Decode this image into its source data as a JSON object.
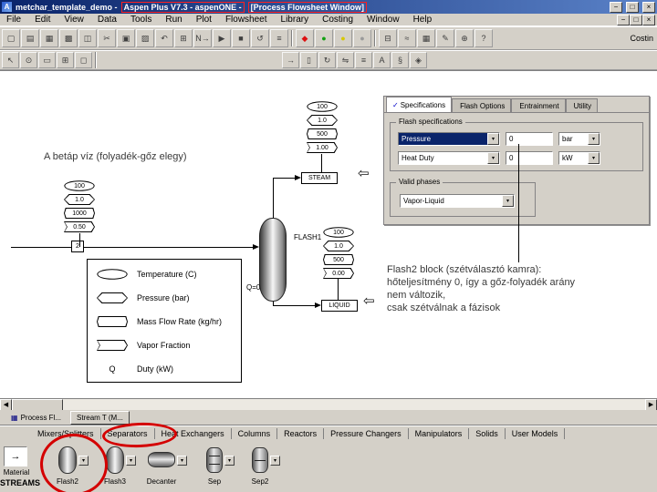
{
  "colors": {
    "title-blue-1": "#0a246a",
    "title-blue-2": "#5a82c8",
    "chrome": "#d4d0c8",
    "select-blue": "#0a246a",
    "check-blue": "#0000c8",
    "status-red": "#dd1111",
    "status-green": "#11a011",
    "status-yellow": "#d8c800",
    "status-gray": "#9a9a9a",
    "annotation-red": "#d40000"
  },
  "icons": {
    "dropdown": "▾",
    "scroll_left": "◀",
    "scroll_right": "▶",
    "flowsheet_tab": "▦",
    "material_arrow": "→",
    "callout_arrow": "⇦",
    "mdi_minimize": "−",
    "mdi_restore": "□",
    "mdi_close": "×"
  },
  "titlebar": {
    "icon": "A",
    "title_plain": "metchar_template_demo -",
    "title_boxed_1": "Aspen Plus V7.3 - aspenONE -",
    "title_boxed_2": "[Process Flowsheet Window]",
    "minimize": "−",
    "maximize": "□",
    "close": "×"
  },
  "menu": {
    "items": [
      "File",
      "Edit",
      "View",
      "Data",
      "Tools",
      "Run",
      "Plot",
      "Flowsheet",
      "Library",
      "Costing",
      "Window",
      "Help"
    ]
  },
  "toolbar1": {
    "left_icons": [
      {
        "name": "new-icon",
        "glyph": "▢"
      },
      {
        "name": "open-icon",
        "glyph": "▤"
      },
      {
        "name": "save-icon",
        "glyph": "▦"
      },
      {
        "name": "print-icon",
        "glyph": "▩"
      },
      {
        "name": "print-preview-icon",
        "glyph": "◫"
      },
      {
        "name": "cut-icon",
        "glyph": "✂"
      },
      {
        "name": "copy-icon",
        "glyph": "▣"
      },
      {
        "name": "paste-icon",
        "glyph": "▨"
      },
      {
        "name": "undo-icon",
        "glyph": "↶"
      },
      {
        "name": "data-browser-icon",
        "glyph": "⊞"
      },
      {
        "name": "next-input-icon",
        "glyph": "N→"
      },
      {
        "name": "run-icon",
        "glyph": "▶"
      },
      {
        "name": "stop-icon",
        "glyph": "■"
      },
      {
        "name": "reinitialize-icon",
        "glyph": "↺"
      },
      {
        "name": "control-panel-icon",
        "glyph": "≡"
      }
    ],
    "status": [
      "◆",
      "●",
      "●",
      "●"
    ],
    "right_icons": [
      {
        "name": "stream-results-icon",
        "glyph": "⊟"
      },
      {
        "name": "plot-icon",
        "glyph": "≈"
      },
      {
        "name": "table-icon",
        "glyph": "▦"
      },
      {
        "name": "annotate-icon",
        "glyph": "✎"
      },
      {
        "name": "zoom-icon",
        "glyph": "⊕"
      },
      {
        "name": "help-icon",
        "glyph": "?"
      }
    ],
    "overflow_label": "Costin"
  },
  "toolbar2": {
    "left_icons": [
      {
        "name": "select-mode-icon",
        "glyph": "↖"
      },
      {
        "name": "pan-icon",
        "glyph": "⊙"
      },
      {
        "name": "zoom-area-icon",
        "glyph": "▭"
      },
      {
        "name": "grid-icon",
        "glyph": "⊞"
      },
      {
        "name": "page-break-icon",
        "glyph": "◻"
      }
    ],
    "mid_icons": [
      {
        "name": "insert-stream-icon",
        "glyph": "→"
      },
      {
        "name": "insert-block-icon",
        "glyph": "▯"
      },
      {
        "name": "rotate-icon",
        "glyph": "↻"
      },
      {
        "name": "flip-horizontal-icon",
        "glyph": "⇋"
      },
      {
        "name": "align-icon",
        "glyph": "≡"
      },
      {
        "name": "label-icon",
        "glyph": "A"
      },
      {
        "name": "section-icon",
        "glyph": "§"
      },
      {
        "name": "view-options-icon",
        "glyph": "◈"
      }
    ]
  },
  "flowsheet": {
    "feed_note": "A betáp víz (folyadék-gőz elegy)",
    "flash_note_lines": [
      "Flash2 block (szétválasztó kamra):",
      "hőteljesítmény 0, így a gőz-folyadék arány",
      "nem változik,",
      "csak szétválnak a fázisok"
    ],
    "streams": {
      "steam": {
        "label": "STEAM",
        "values": [
          "100",
          "1.0",
          "500",
          "1.00"
        ]
      },
      "feed": {
        "label": "2",
        "values": [
          "100",
          "1.0",
          "1000",
          "0.50"
        ]
      },
      "liquid": {
        "label": "LIQUID",
        "values": [
          "100",
          "1.0",
          "500",
          "0.00"
        ]
      }
    },
    "block": {
      "label": "FLASH1",
      "duty": "Q=0"
    },
    "legend": {
      "rows": [
        {
          "label": "Temperature (C)"
        },
        {
          "label": "Pressure (bar)"
        },
        {
          "label": "Mass Flow Rate (kg/hr)"
        },
        {
          "label": "Vapor Fraction"
        },
        {
          "symbol": "Q",
          "label": "Duty (kW)"
        }
      ]
    }
  },
  "form": {
    "tabs": [
      {
        "check": "✓",
        "label": "Specifications"
      },
      {
        "label": "Flash Options"
      },
      {
        "label": "Entrainment"
      },
      {
        "label": "Utility"
      }
    ],
    "group1_title": "Flash specifications",
    "rows": [
      {
        "field": "Pressure",
        "value": "0",
        "unit": "bar"
      },
      {
        "field": "Heat Duty",
        "value": "0",
        "unit": "kW"
      }
    ],
    "group2_title": "Valid phases",
    "valid_phases": "Vapor-Liquid"
  },
  "bottom": {
    "tabs": [
      {
        "label": "Process Fl..."
      },
      {
        "label": "Stream T (M..."
      }
    ]
  },
  "library": {
    "tabs": [
      "Mixers/Splitters",
      "Separators",
      "Heat Exchangers",
      "Columns",
      "Reactors",
      "Pressure Changers",
      "Manipulators",
      "Solids",
      "User Models"
    ],
    "material_label": "Material",
    "streams_label": "STREAMS",
    "items": [
      {
        "label": "Flash2"
      },
      {
        "label": "Flash3"
      },
      {
        "label": "Decanter"
      },
      {
        "label": "Sep"
      },
      {
        "label": "Sep2"
      }
    ]
  }
}
